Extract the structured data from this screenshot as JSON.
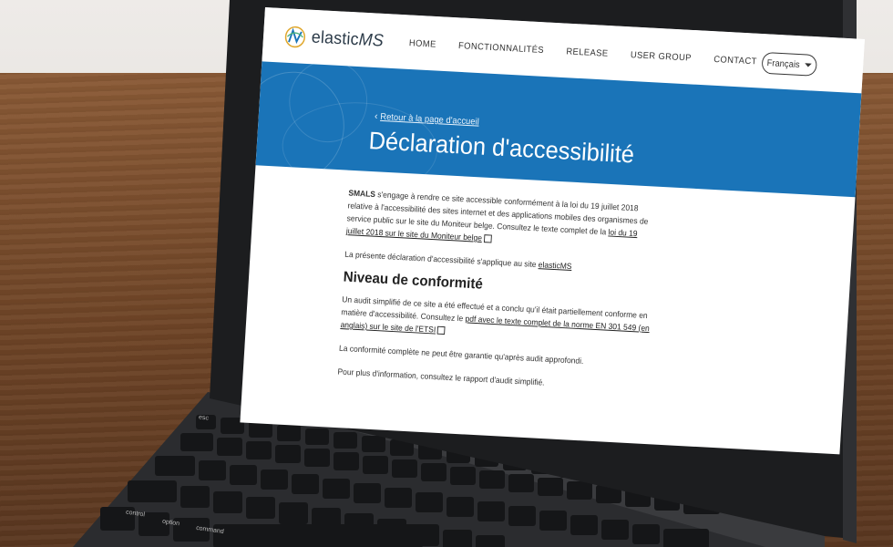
{
  "site": {
    "logo_text_main": "elastic",
    "logo_text_suffix": "MS"
  },
  "nav": {
    "items": [
      "HOME",
      "FONCTIONNALITÉS",
      "RELEASE",
      "USER GROUP",
      "CONTACT"
    ],
    "language": "Français"
  },
  "hero": {
    "back_link": "Retour à la page d'accueil",
    "title": "Déclaration d'accessibilité"
  },
  "content": {
    "p1_strong": "SMALS",
    "p1_text": " s'engage à rendre ce site accessible conformément à la loi du 19 juillet 2018 relative à l'accessibilité des sites internet et des applications mobiles des organismes de service public sur le site du Moniteur belge. Consultez le texte complet de la ",
    "p1_link": "loi du 19 juillet 2018 sur le site du Moniteur belge",
    "p2_text": "La présente déclaration d'accessibilité s'applique au site ",
    "p2_link": "elasticMS",
    "h2": "Niveau de conformité",
    "p3_text": "Un audit simplifié de ce site a été effectué et a conclu qu'il était partiellement conforme en matière d'accessibilité. Consultez le ",
    "p3_link": "pdf avec le texte complet de la norme EN 301 549 (en anglais) sur le site de l'ETSI",
    "p4_text": "La conformité complète ne peut être garantie qu'après audit approfondi.",
    "p5_text": "Pour plus d'information, consultez le rapport d'audit simplifié."
  },
  "keyboard": {
    "keys": [
      "esc",
      "control",
      "option",
      "command"
    ]
  },
  "colors": {
    "brand_blue": "#1a74b8",
    "wood": "#7a4c2c"
  }
}
